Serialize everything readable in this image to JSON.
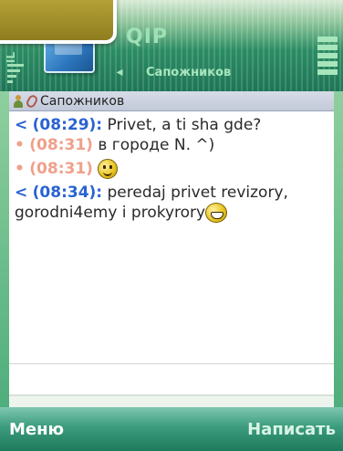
{
  "app": {
    "title": "QIP",
    "left_indicator": "IL"
  },
  "nav": {
    "left_arrow": "◂",
    "active_tab": "Сапожников"
  },
  "contact": {
    "name": "Сапожников"
  },
  "messages": [
    {
      "direction": "out",
      "marker": "<",
      "time": "(08:29):",
      "text": " Privet, a ti sha gde?"
    },
    {
      "direction": "in",
      "marker": "•",
      "time": "(08:31)",
      "text": " в городе N. ^)"
    },
    {
      "direction": "in",
      "marker": "•",
      "time": "(08:31)",
      "text": " ",
      "emoticon": "smile"
    },
    {
      "direction": "out",
      "marker": "<",
      "time": "(08:34):",
      "text": " peredaj privet revizory, gorodni4emy i prokyrory",
      "emoticon": "laugh"
    }
  ],
  "softkeys": {
    "left": "Меню",
    "right": "Написать"
  },
  "colors": {
    "outgoing_time": "#2a63d1",
    "incoming_time": "#f0a08a",
    "softkey_bg": "#2f8f6c"
  }
}
